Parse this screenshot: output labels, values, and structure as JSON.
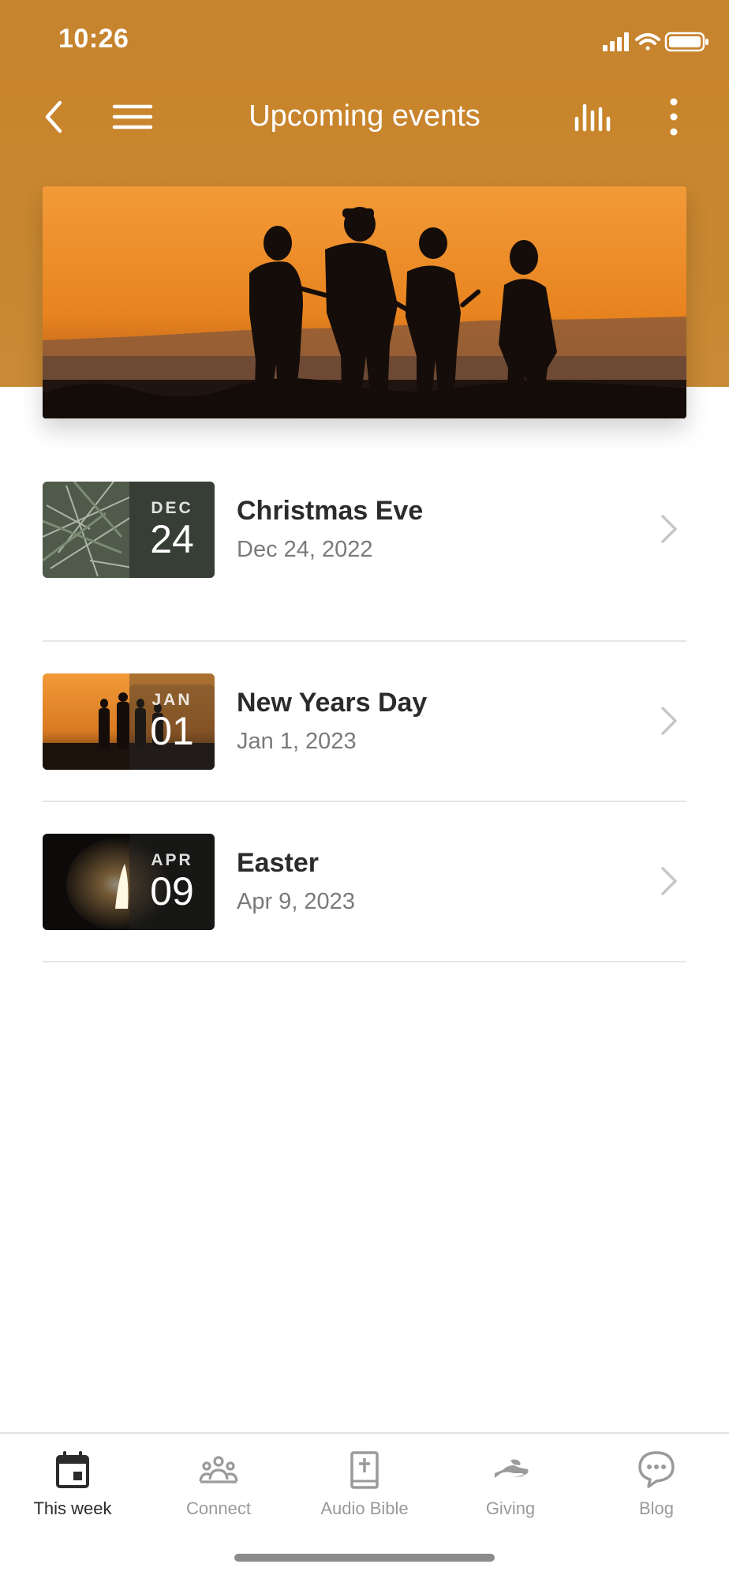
{
  "status_bar": {
    "time": "10:26"
  },
  "header": {
    "title": "Upcoming events",
    "back_icon": "chevron-left-icon",
    "menu_icon": "hamburger-icon",
    "audio_icon": "audio-levels-icon",
    "more_icon": "vertical-dots-icon",
    "background_color": "#c7842e"
  },
  "hero": {
    "image": "family-sunset-silhouette"
  },
  "events": [
    {
      "title": "Christmas Eve",
      "date": "Dec 24, 2022",
      "month": "DEC",
      "day": "24",
      "thumbnail": "pine-branches"
    },
    {
      "title": "New Years Day",
      "date": "Jan 1, 2023",
      "month": "JAN",
      "day": "01",
      "thumbnail": "family-sunset-silhouette"
    },
    {
      "title": "Easter",
      "date": "Apr 9, 2023",
      "month": "APR",
      "day": "09",
      "thumbnail": "empty-tomb"
    }
  ],
  "tabs": [
    {
      "label": "This week",
      "icon": "calendar-icon",
      "active": true
    },
    {
      "label": "Connect",
      "icon": "people-icon",
      "active": false
    },
    {
      "label": "Audio Bible",
      "icon": "bible-icon",
      "active": false
    },
    {
      "label": "Giving",
      "icon": "giving-hand-icon",
      "active": false
    },
    {
      "label": "Blog",
      "icon": "chat-bubble-icon",
      "active": false
    }
  ]
}
